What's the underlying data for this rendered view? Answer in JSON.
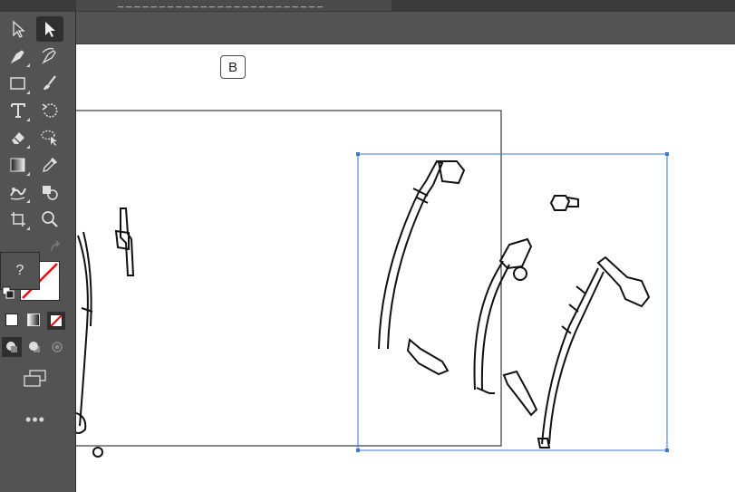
{
  "app": {
    "document_tab_title": "_ _ _ _ _ _ _ _ _ _ _ _ _ _ _ _ _ _ _ _ _ _ _ _ _"
  },
  "toolbar": {
    "tools": [
      {
        "name": "selection-tool",
        "icon": "arrow-outline-icon",
        "active": false
      },
      {
        "name": "direct-selection-tool",
        "icon": "arrow-filled-icon",
        "active": true
      },
      {
        "name": "pen-tool",
        "icon": "pen-icon",
        "active": false
      },
      {
        "name": "curvature-tool",
        "icon": "curvature-pen-icon",
        "active": false
      },
      {
        "name": "rectangle-tool",
        "icon": "rectangle-icon",
        "active": false
      },
      {
        "name": "paintbrush-tool",
        "icon": "paintbrush-icon",
        "active": false
      },
      {
        "name": "type-tool",
        "icon": "type-icon",
        "active": false
      },
      {
        "name": "rotate-tool",
        "icon": "rotate-icon",
        "active": false
      },
      {
        "name": "eraser-tool",
        "icon": "eraser-icon",
        "active": false
      },
      {
        "name": "lasso-tool",
        "icon": "lasso-icon",
        "active": false
      },
      {
        "name": "gradient-tool",
        "icon": "gradient-icon",
        "active": false
      },
      {
        "name": "eyedropper-tool",
        "icon": "eyedropper-icon",
        "active": false
      },
      {
        "name": "puppet-warp-tool",
        "icon": "puppet-warp-icon",
        "active": false
      },
      {
        "name": "shape-builder-tool",
        "icon": "shape-builder-icon",
        "active": false
      },
      {
        "name": "artboard-tool",
        "icon": "artboard-icon",
        "active": false
      },
      {
        "name": "zoom-tool",
        "icon": "zoom-icon",
        "active": false
      }
    ],
    "tooltip_text": "?",
    "more_label": "•••",
    "fill_color": "#ffffff",
    "stroke_color": "none"
  },
  "canvas": {
    "artboard_label": "B",
    "selection_color": "#3c78d8"
  }
}
